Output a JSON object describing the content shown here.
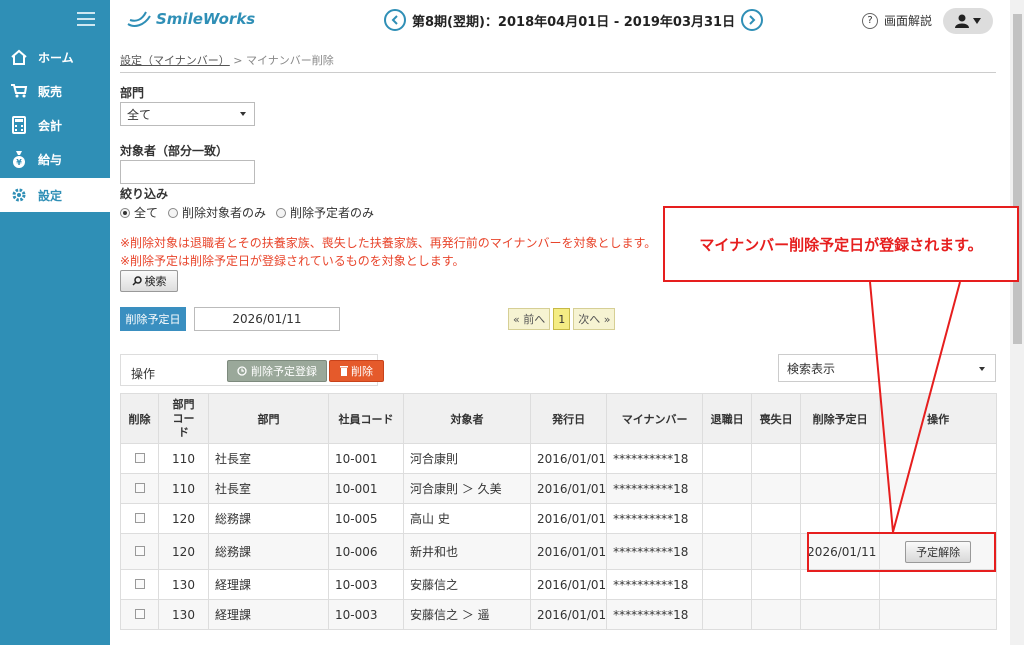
{
  "app": {
    "logo_text": "SmileWorks"
  },
  "sidebar": {
    "items": [
      {
        "label": "ホーム",
        "icon": "home-icon"
      },
      {
        "label": "販売",
        "icon": "cart-icon"
      },
      {
        "label": "会計",
        "icon": "calculator-icon"
      },
      {
        "label": "給与",
        "icon": "money-bag-icon"
      },
      {
        "label": "設定",
        "icon": "gear-icon",
        "active": true
      }
    ]
  },
  "header": {
    "period": "第8期(翌期)：2018年04月01日 - 2019年03月31日",
    "help_label": "画面解説"
  },
  "breadcrumb": {
    "parent": "設定（マイナンバー）",
    "separator": ">",
    "current": "マイナンバー削除"
  },
  "filters": {
    "department_label": "部門",
    "department_value": "全て",
    "target_label": "対象者（部分一致）",
    "target_value": "",
    "narrow_label": "絞り込み",
    "radios": [
      "全て",
      "削除対象者のみ",
      "削除予定者のみ"
    ],
    "notice1": "※削除対象は退職者とその扶養家族、喪失した扶養家族、再発行前のマイナンバーを対象とします。",
    "notice2": "※削除予定は削除予定日が登録されているものを対象とします。",
    "search_button": "検索"
  },
  "schedule": {
    "tag": "削除予定日",
    "date": "2026/01/11"
  },
  "pager": {
    "prev": "« 前へ",
    "page": "1",
    "next": "次へ »"
  },
  "ops": {
    "label": "操作",
    "register_button": "削除予定登録",
    "delete_button": "削除",
    "view_select": "検索表示"
  },
  "table": {
    "headers": [
      "削除",
      "部門コード",
      "部門",
      "社員コード",
      "対象者",
      "発行日",
      "マイナンバー",
      "退職日",
      "喪失日",
      "削除予定日",
      "操作"
    ],
    "rows": [
      {
        "dept_code": "110",
        "dept": "社長室",
        "emp_code": "10-001",
        "name": "河合康則",
        "issued": "2016/01/01",
        "mynumber": "**********18",
        "retire": "",
        "loss": "",
        "scheduled": "",
        "action": ""
      },
      {
        "dept_code": "110",
        "dept": "社長室",
        "emp_code": "10-001",
        "name": "河合康則 ＞ 久美",
        "issued": "2016/01/01",
        "mynumber": "**********18",
        "retire": "",
        "loss": "",
        "scheduled": "",
        "action": ""
      },
      {
        "dept_code": "120",
        "dept": "総務課",
        "emp_code": "10-005",
        "name": "高山 史",
        "issued": "2016/01/01",
        "mynumber": "**********18",
        "retire": "",
        "loss": "",
        "scheduled": "",
        "action": ""
      },
      {
        "dept_code": "120",
        "dept": "総務課",
        "emp_code": "10-006",
        "name": "新井和也",
        "issued": "2016/01/01",
        "mynumber": "**********18",
        "retire": "",
        "loss": "",
        "scheduled": "2026/01/11",
        "action": "予定解除"
      },
      {
        "dept_code": "130",
        "dept": "経理課",
        "emp_code": "10-003",
        "name": "安藤信之",
        "issued": "2016/01/01",
        "mynumber": "**********18",
        "retire": "",
        "loss": "",
        "scheduled": "",
        "action": ""
      },
      {
        "dept_code": "130",
        "dept": "経理課",
        "emp_code": "10-003",
        "name": "安藤信之 ＞ 遥",
        "issued": "2016/01/01",
        "mynumber": "**********18",
        "retire": "",
        "loss": "",
        "scheduled": "",
        "action": ""
      }
    ]
  },
  "callout": {
    "text": "マイナンバー削除予定日が登録されます。"
  },
  "colors": {
    "sidebar": "#2f8fb6",
    "accent_red": "#e61e1e",
    "notice": "#e8452c"
  }
}
